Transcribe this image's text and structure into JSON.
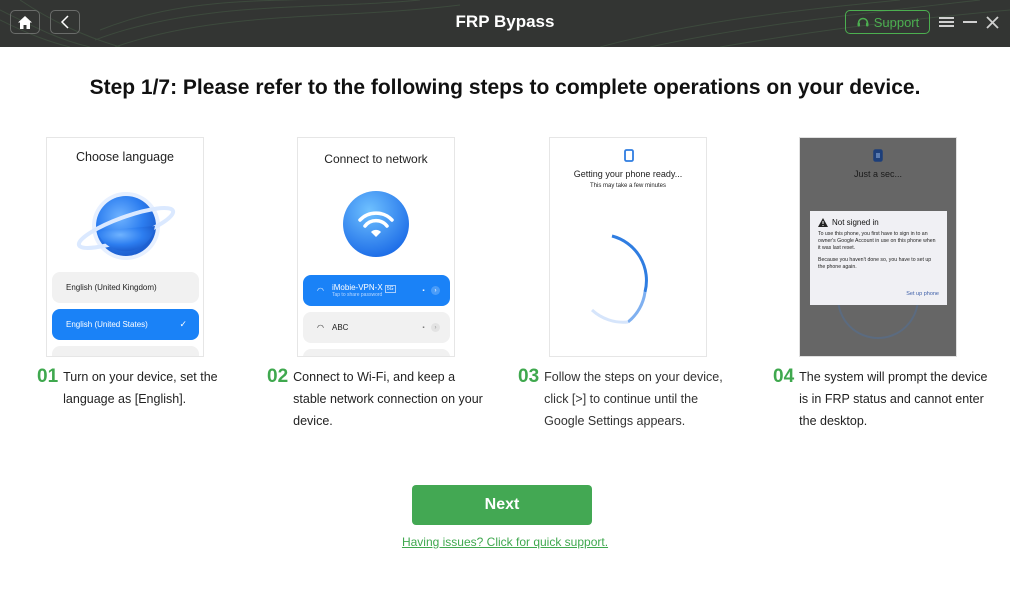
{
  "titlebar": {
    "title": "FRP Bypass",
    "home_icon": "home-icon",
    "back_icon": "chevron-left-icon",
    "support_label": "Support",
    "support_icon": "headset-icon",
    "menu_icon": "hamburger-menu-icon",
    "minimize_icon": "minimize-icon",
    "close_icon": "close-icon"
  },
  "main": {
    "heading": "Step 1/7: Please refer to the following steps to complete operations on your device.",
    "cards": [
      {
        "title": "Choose language",
        "options": [
          "English (United Kingdom)",
          "English (United States)"
        ],
        "selected": "English (United States)"
      },
      {
        "title": "Connect to network",
        "networks": [
          {
            "name": "iMobie-VPN-X",
            "badge": "5G",
            "subtitle": "Tap to share password"
          },
          {
            "name": "ABC"
          }
        ]
      },
      {
        "title": "Getting your phone ready...",
        "subtitle": "This may take a few minutes"
      },
      {
        "title": "Just a sec...",
        "dialog_title": "Not signed in",
        "dialog_p1": "To use this phone, you first have to sign in to an owner's Google Account in use on this phone when it was last reset.",
        "dialog_p2": "Because you haven't done so, you have to set up the phone again.",
        "dialog_action": "Set up phone"
      }
    ],
    "steps": [
      {
        "num": "01",
        "text": "Turn on your device, set the language as [English]."
      },
      {
        "num": "02",
        "text": "Connect to Wi-Fi, and keep a stable network connection on your device."
      },
      {
        "num": "03",
        "text": "Follow the steps on your device, click [>] to continue until the Google Settings appears."
      },
      {
        "num": "04",
        "text": "The system will prompt the device is in FRP status and cannot enter the desktop."
      }
    ],
    "next_label": "Next",
    "help_link": "Having issues? Click for quick support."
  },
  "colors": {
    "accent_green": "#43a853",
    "titlebar_bg": "#333533",
    "phone_blue": "#1a82f7"
  }
}
